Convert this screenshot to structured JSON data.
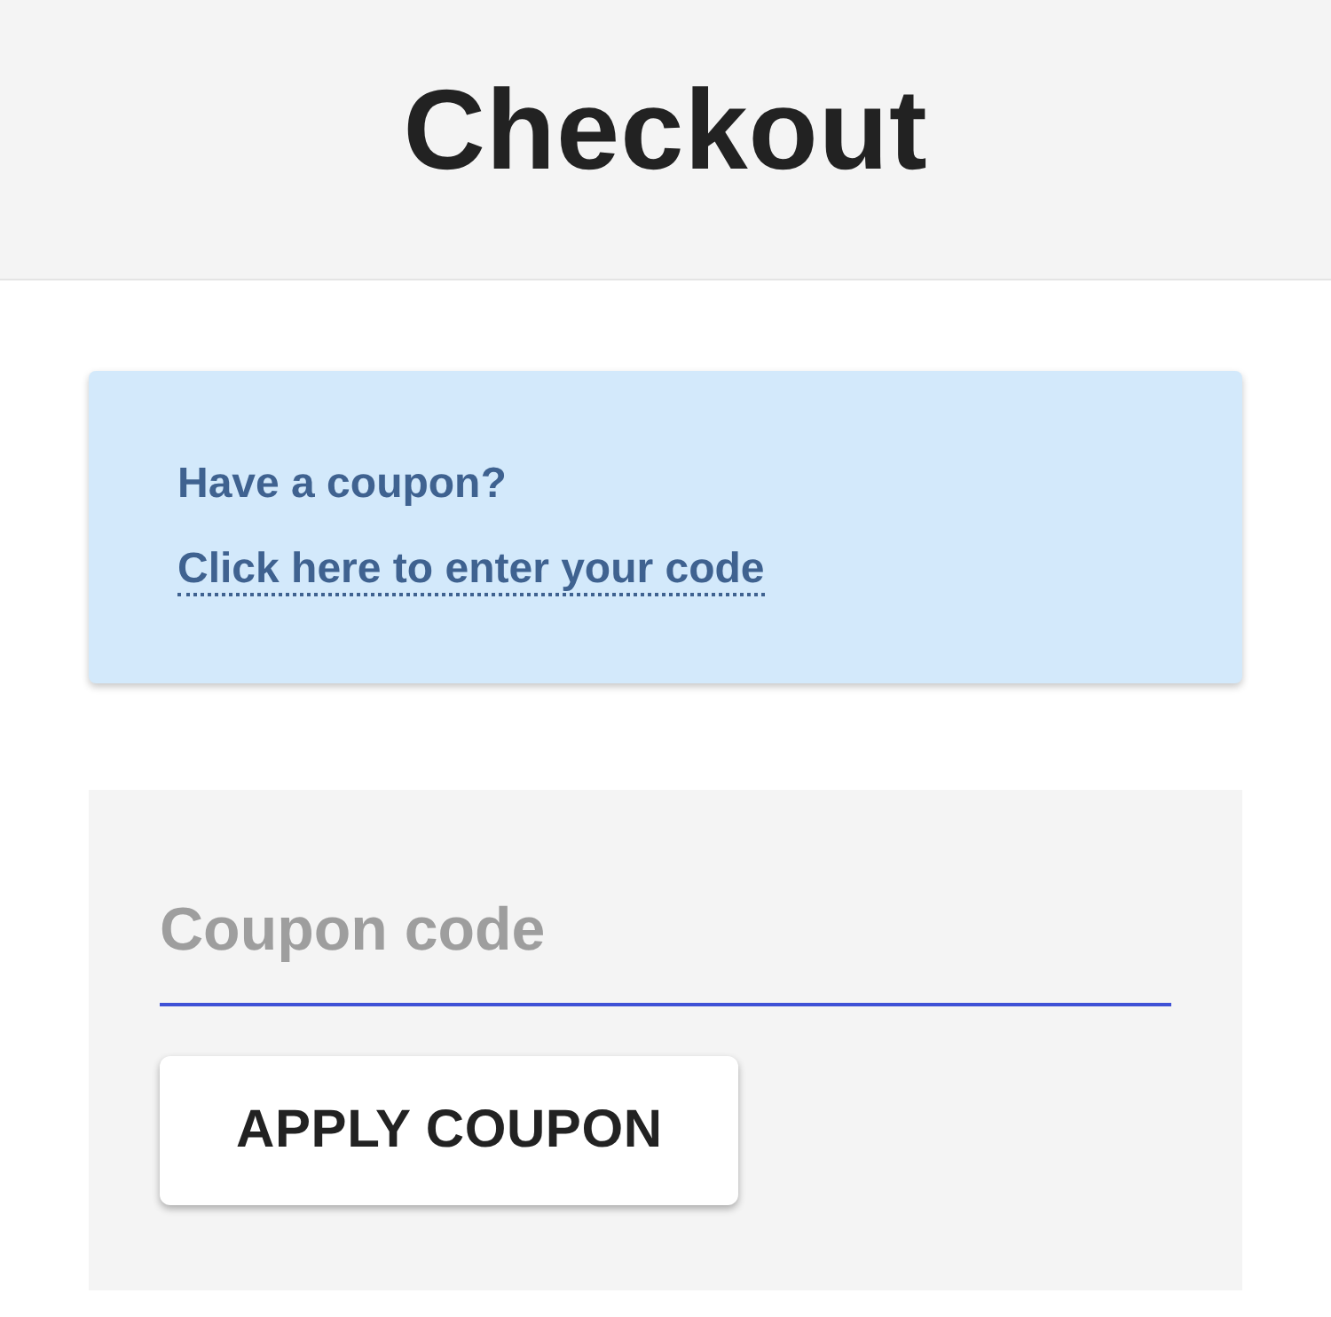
{
  "header": {
    "title": "Checkout"
  },
  "coupon_notice": {
    "text": "Have a coupon?",
    "link": "Click here to enter your code"
  },
  "coupon_form": {
    "field": {
      "placeholder": "Coupon code",
      "focused": true
    },
    "button": "APPLY COUPON"
  }
}
